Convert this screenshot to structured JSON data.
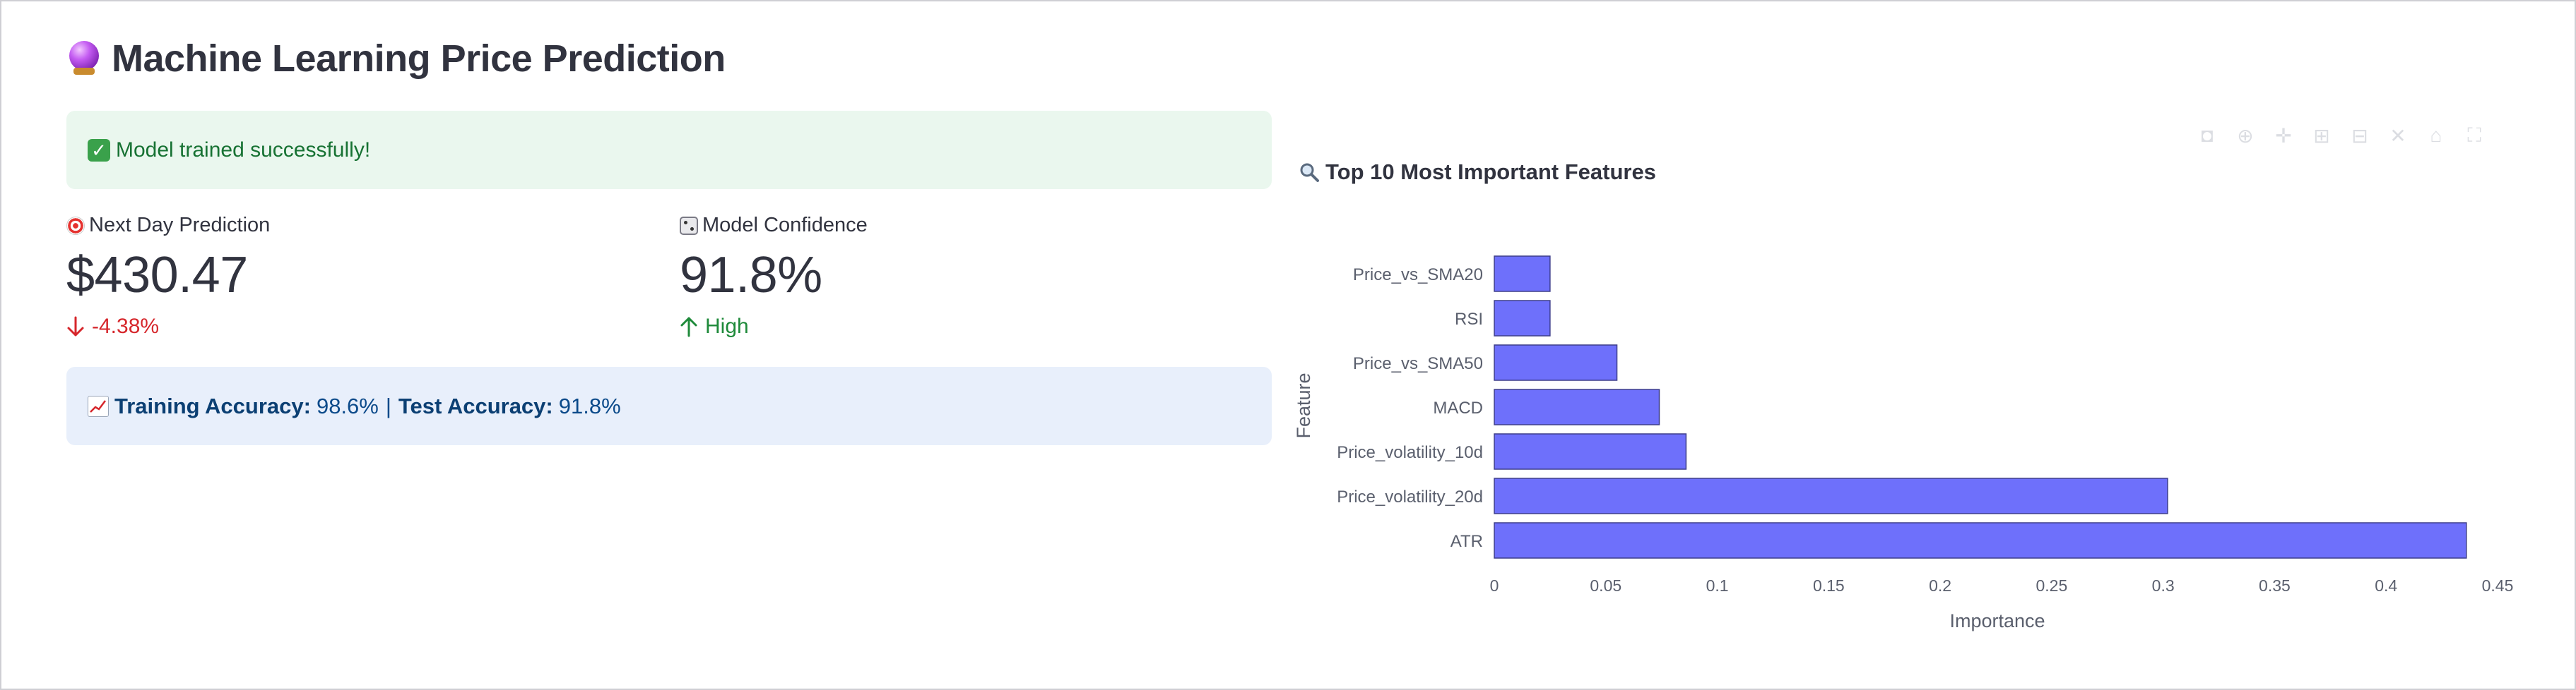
{
  "page": {
    "title": "Machine Learning Price Prediction",
    "title_icon": "crystal-ball-icon"
  },
  "status": {
    "success_message": "Model trained successfully!",
    "success_icon": "check-mark-icon"
  },
  "metrics": [
    {
      "label": "Next Day Prediction",
      "icon": "target-icon",
      "value": "$430.47",
      "delta": "-4.38%",
      "delta_direction": "down"
    },
    {
      "label": "Model Confidence",
      "icon": "dice-icon",
      "value": "91.8%",
      "delta": "High",
      "delta_direction": "up"
    }
  ],
  "accuracy": {
    "icon": "chart-increasing-icon",
    "training_label": "Training Accuracy:",
    "training_value": "98.6%",
    "separator": "|",
    "test_label": "Test Accuracy:",
    "test_value": "91.8%"
  },
  "colors": {
    "bar": "#6e70fb",
    "bar_border": "#3e3f8a",
    "success_bg": "#eaf7ee",
    "info_bg": "#e8effb",
    "delta_negative": "#d6262b",
    "delta_positive": "#1e8a3a"
  },
  "chart_data": {
    "type": "bar",
    "orientation": "horizontal",
    "title": "Top 10 Most Important Features",
    "title_icon": "magnifying-glass-icon",
    "categories": [
      "Price_vs_SMA20",
      "RSI",
      "Price_vs_SMA50",
      "MACD",
      "Price_volatility_10d",
      "Price_volatility_20d",
      "ATR"
    ],
    "values": [
      0.025,
      0.025,
      0.055,
      0.074,
      0.086,
      0.302,
      0.436
    ],
    "xlabel": "Importance",
    "ylabel": "Feature",
    "xlim": [
      0,
      0.45
    ],
    "xticks": [
      "0",
      "0.05",
      "0.1",
      "0.15",
      "0.2",
      "0.25",
      "0.3",
      "0.35",
      "0.4",
      "0.45"
    ],
    "grid": false
  }
}
